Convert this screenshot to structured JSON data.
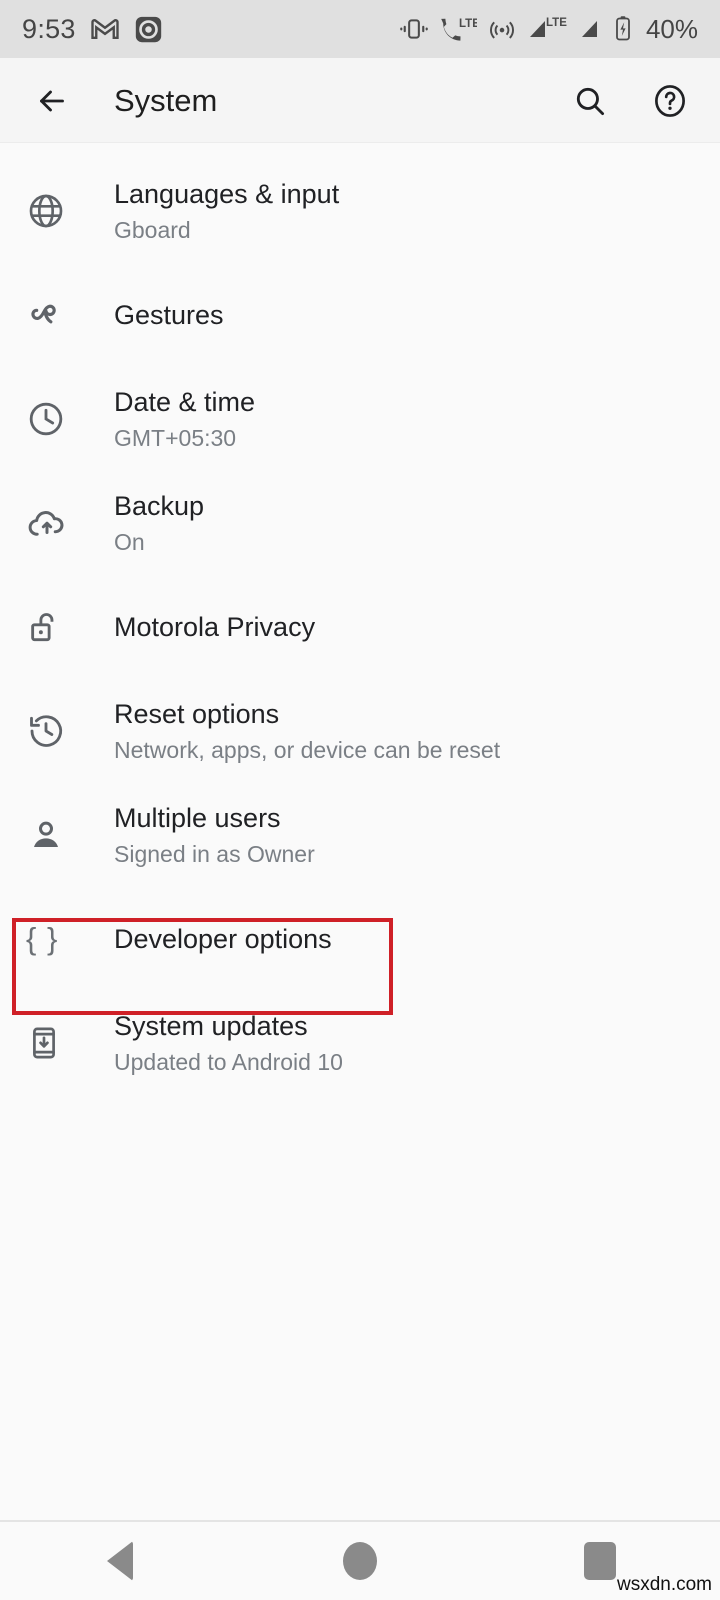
{
  "status_bar": {
    "time": "9:53",
    "battery_percent": "40%",
    "left_icons": [
      "gmail-icon",
      "screen-recorder-icon"
    ],
    "right_icons": [
      "vibrate-icon",
      "volte-icon",
      "hotspot-icon",
      "signal-lte-icon",
      "signal-icon",
      "battery-charging-icon"
    ],
    "lte_label": "LTE",
    "lte_label_2": "LTE",
    "background": "#e0e0e0"
  },
  "toolbar": {
    "back_label": "Back",
    "title": "System",
    "search_label": "Search",
    "help_label": "Help"
  },
  "list": {
    "items": [
      {
        "icon": "globe-icon",
        "title": "Languages & input",
        "subtitle": "Gboard"
      },
      {
        "icon": "gesture-icon",
        "title": "Gestures",
        "subtitle": ""
      },
      {
        "icon": "clock-icon",
        "title": "Date & time",
        "subtitle": "GMT+05:30"
      },
      {
        "icon": "cloud-upload-icon",
        "title": "Backup",
        "subtitle": "On"
      },
      {
        "icon": "unlock-icon",
        "title": "Motorola Privacy",
        "subtitle": ""
      },
      {
        "icon": "history-icon",
        "title": "Reset options",
        "subtitle": "Network, apps, or device can be reset"
      },
      {
        "icon": "person-icon",
        "title": "Multiple users",
        "subtitle": "Signed in as Owner"
      },
      {
        "icon": "braces-icon",
        "title": "Developer options",
        "subtitle": ""
      },
      {
        "icon": "system-update-icon",
        "title": "System updates",
        "subtitle": "Updated to Android 10"
      }
    ]
  },
  "highlight": {
    "target": "Developer options",
    "color": "#cf2027"
  },
  "nav_bar": {
    "back_label": "Back",
    "home_label": "Home",
    "recents_label": "Recents"
  },
  "watermark": {
    "text": "wsxdn.com"
  }
}
